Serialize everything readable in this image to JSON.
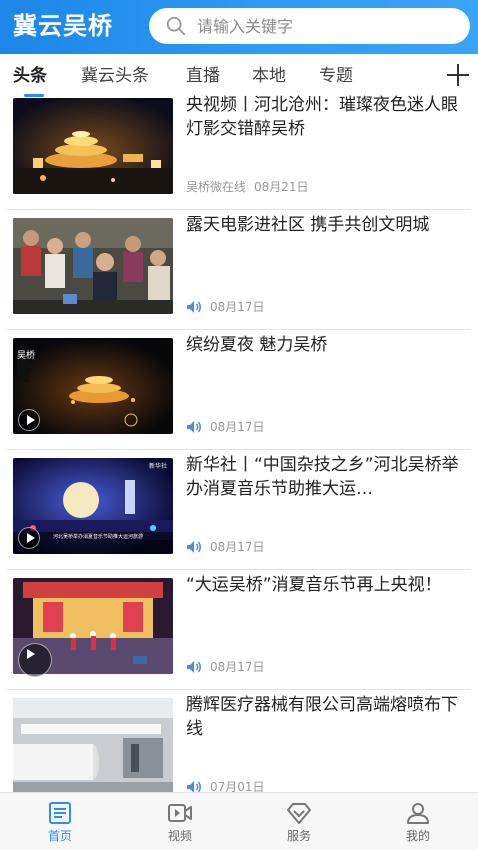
{
  "header": {
    "app_title": "冀云吴桥",
    "search_placeholder": "请输入关键字"
  },
  "tabs": [
    {
      "label": "头条",
      "active": true
    },
    {
      "label": "冀云头条",
      "active": false
    },
    {
      "label": "直播",
      "active": false
    },
    {
      "label": "本地",
      "active": false
    },
    {
      "label": "专题",
      "active": false
    }
  ],
  "news": [
    {
      "title": "央视频丨河北沧州：璀璨夜色迷人眼 灯影交错醉吴桥",
      "source": "吴桥微在线",
      "date": "08月21日",
      "audio": false,
      "video": false
    },
    {
      "title": "露天电影进社区 携手共创文明城",
      "source": "",
      "date": "08月17日",
      "audio": true,
      "video": false
    },
    {
      "title": "缤纷夏夜 魅力吴桥",
      "source": "",
      "date": "08月17日",
      "audio": true,
      "video": true
    },
    {
      "title": "新华社丨“中国杂技之乡”河北吴桥举办消夏音乐节助推大运…",
      "source": "",
      "date": "08月17日",
      "audio": true,
      "video": true
    },
    {
      "title": "“大运吴桥”消夏音乐节再上央视！",
      "source": "",
      "date": "08月17日",
      "audio": true,
      "video": true
    },
    {
      "title": "腾辉医疗器械有限公司高端熔喷布下线",
      "source": "",
      "date": "07月01日",
      "audio": true,
      "video": false
    }
  ],
  "thumb_overlays": {
    "item3_brand": "吴桥",
    "item4_caption": "河北吴桥举办消夏音乐节助推大运河旅游",
    "item4_brand": "新华社"
  },
  "bottom_nav": [
    {
      "label": "首页",
      "icon": "news-icon",
      "active": true
    },
    {
      "label": "视频",
      "icon": "video-icon",
      "active": false
    },
    {
      "label": "服务",
      "icon": "service-icon",
      "active": false
    },
    {
      "label": "我的",
      "icon": "profile-icon",
      "active": false
    }
  ],
  "colors": {
    "accent": "#2a8ff0",
    "header_start": "#1d86e8",
    "header_end": "#3aa5f6"
  }
}
